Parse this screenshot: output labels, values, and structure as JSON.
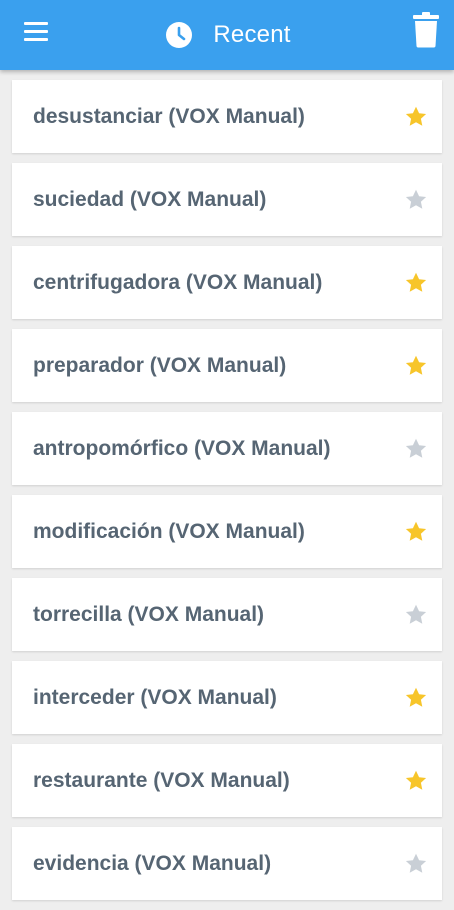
{
  "colors": {
    "app_bar": "#3aa0ee",
    "star_active": "#f7c52a",
    "star_inactive": "#c9cfd6",
    "item_text": "#566573"
  },
  "header": {
    "title": "Recent",
    "left_icon": "menu-icon",
    "title_icon": "clock-icon",
    "right_icon": "trash-icon"
  },
  "items": [
    {
      "label": "desustanciar (VOX Manual)",
      "starred": true
    },
    {
      "label": "suciedad (VOX Manual)",
      "starred": false
    },
    {
      "label": "centrifugadora (VOX Manual)",
      "starred": true
    },
    {
      "label": "preparador (VOX Manual)",
      "starred": true
    },
    {
      "label": "antropomórfico (VOX Manual)",
      "starred": false
    },
    {
      "label": "modificación (VOX Manual)",
      "starred": true
    },
    {
      "label": "torrecilla (VOX Manual)",
      "starred": false
    },
    {
      "label": "interceder (VOX Manual)",
      "starred": true
    },
    {
      "label": "restaurante (VOX Manual)",
      "starred": true
    },
    {
      "label": "evidencia (VOX Manual)",
      "starred": false
    }
  ]
}
